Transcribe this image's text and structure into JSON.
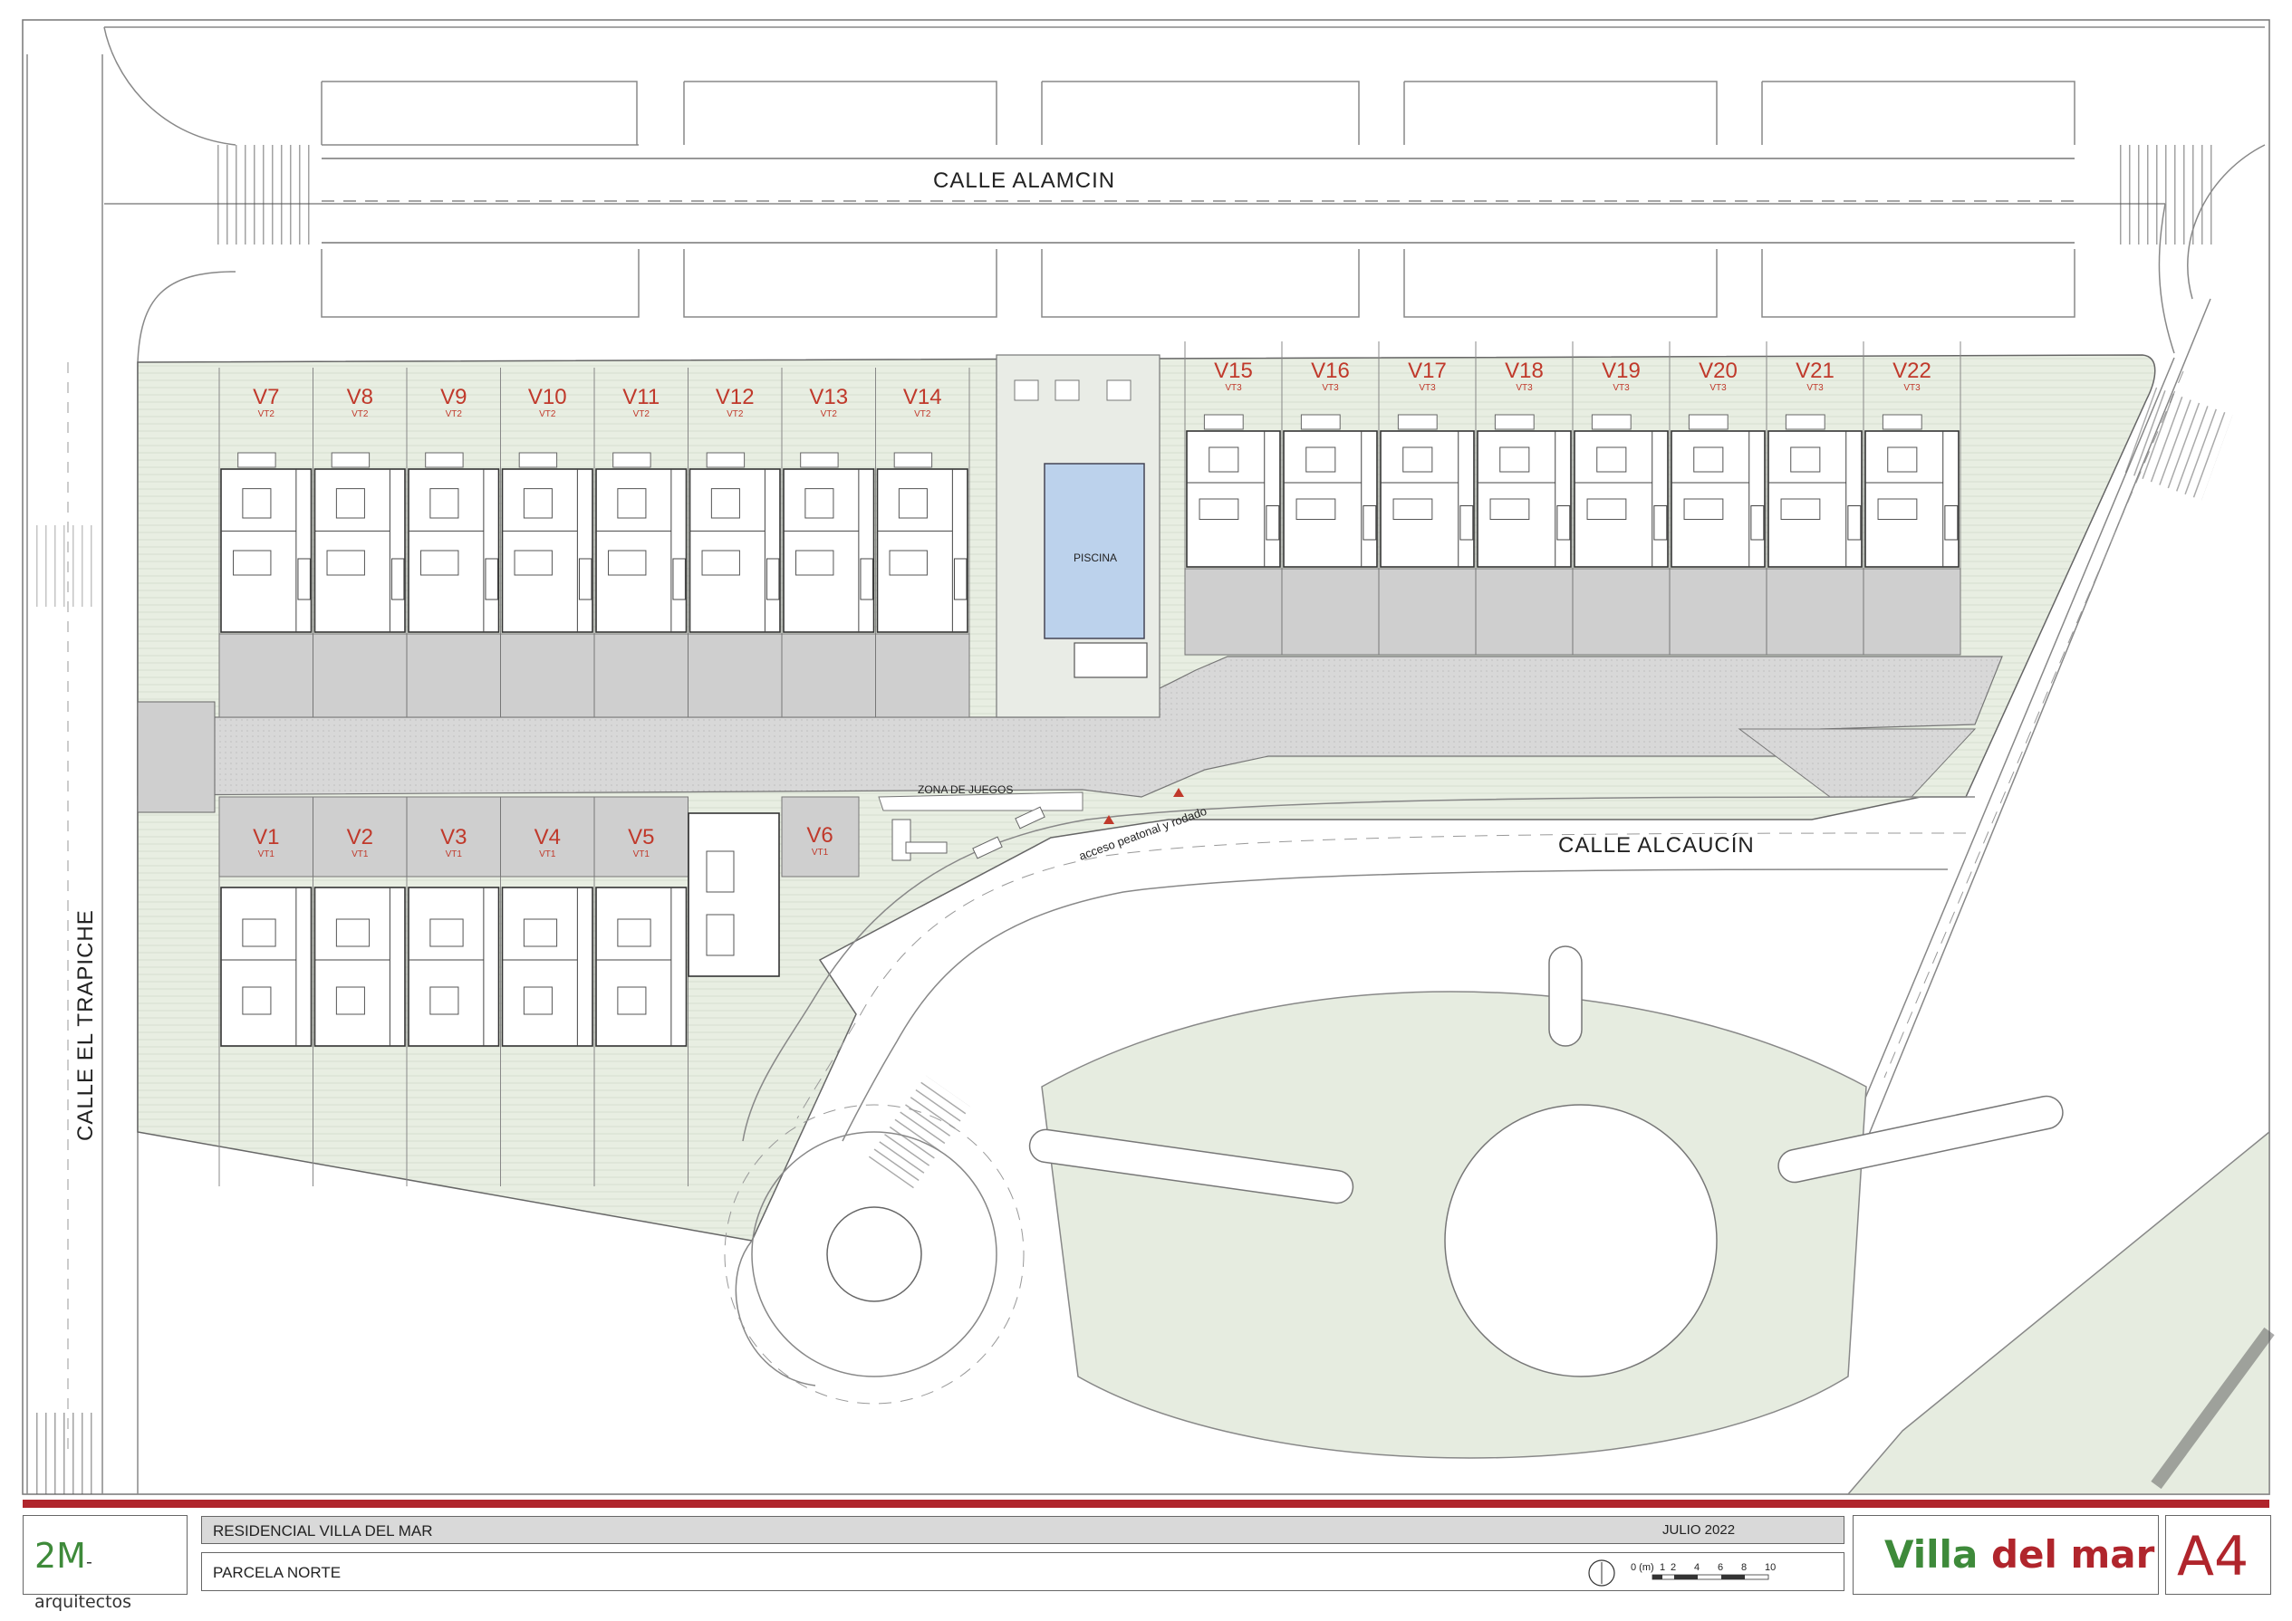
{
  "streets": {
    "north": "CALLE ALAMCIN",
    "west": "CALLE EL TRAPICHE",
    "south": "CALLE ALCAUCÍN"
  },
  "amenities": {
    "pool": "PISCINA",
    "playground": "ZONA DE JUEGOS",
    "access": "acceso peatonal y rodado"
  },
  "villas_north_west": [
    {
      "label": "V7",
      "type": "VT2"
    },
    {
      "label": "V8",
      "type": "VT2"
    },
    {
      "label": "V9",
      "type": "VT2"
    },
    {
      "label": "V10",
      "type": "VT2"
    },
    {
      "label": "V11",
      "type": "VT2"
    },
    {
      "label": "V12",
      "type": "VT2"
    },
    {
      "label": "V13",
      "type": "VT2"
    },
    {
      "label": "V14",
      "type": "VT2"
    }
  ],
  "villas_north_east": [
    {
      "label": "V15",
      "type": "VT3"
    },
    {
      "label": "V16",
      "type": "VT3"
    },
    {
      "label": "V17",
      "type": "VT3"
    },
    {
      "label": "V18",
      "type": "VT3"
    },
    {
      "label": "V19",
      "type": "VT3"
    },
    {
      "label": "V20",
      "type": "VT3"
    },
    {
      "label": "V21",
      "type": "VT3"
    },
    {
      "label": "V22",
      "type": "VT3"
    }
  ],
  "villas_south": [
    {
      "label": "V1",
      "type": "VT1"
    },
    {
      "label": "V2",
      "type": "VT1"
    },
    {
      "label": "V3",
      "type": "VT1"
    },
    {
      "label": "V4",
      "type": "VT1"
    },
    {
      "label": "V5",
      "type": "VT1"
    },
    {
      "label": "V6",
      "type": "VT1"
    }
  ],
  "title_block": {
    "logo_main": "2M",
    "logo_suffix": "-arquitectos",
    "project": "RESIDENCIAL VILLA DEL MAR",
    "date": "JULIO 2022",
    "parcel": "PARCELA NORTE",
    "brand_a": "Villa",
    "brand_b": "del mar",
    "sheet": "A4"
  },
  "scale_bar": {
    "unit": "0 (m)",
    "ticks": [
      "1",
      "2",
      "4",
      "6",
      "8",
      "10"
    ]
  },
  "colors": {
    "accent_red": "#b0252c",
    "logo_green": "#3e8a3a",
    "lawn": "#e6ece0",
    "paving": "#cfcfcf",
    "pool": "#bcd2ec"
  }
}
